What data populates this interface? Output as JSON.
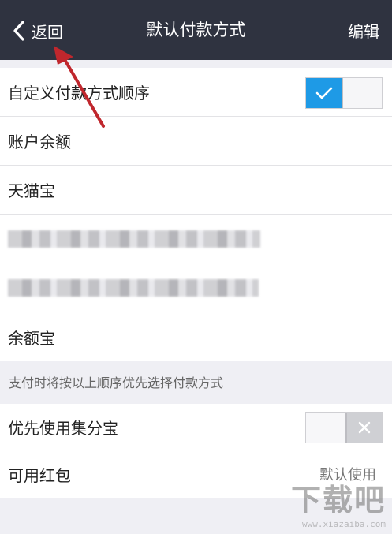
{
  "navbar": {
    "back_label": "返回",
    "title": "默认付款方式",
    "edit_label": "编辑",
    "back_icon": "chevron-left-icon"
  },
  "payment_order": {
    "custom_order_label": "自定义付款方式顺序",
    "custom_order_enabled": true,
    "methods": [
      {
        "label": "账户余额"
      },
      {
        "label": "天猫宝"
      },
      {
        "label": ""
      },
      {
        "label": ""
      },
      {
        "label": "余额宝"
      }
    ]
  },
  "hint_text": "支付时将按以上顺序优先选择付款方式",
  "options": {
    "jifenbao_label": "优先使用集分宝",
    "jifenbao_enabled": false,
    "hongbao_label": "可用红包",
    "hongbao_value": "默认使用"
  },
  "watermark": {
    "logo": "下载吧",
    "url": "www.xiazaiba.com"
  },
  "colors": {
    "navbar_bg": "#2f3340",
    "toggle_on": "#1e9ae6",
    "page_bg": "#efeff4",
    "annotation_arrow": "#c0272d"
  }
}
